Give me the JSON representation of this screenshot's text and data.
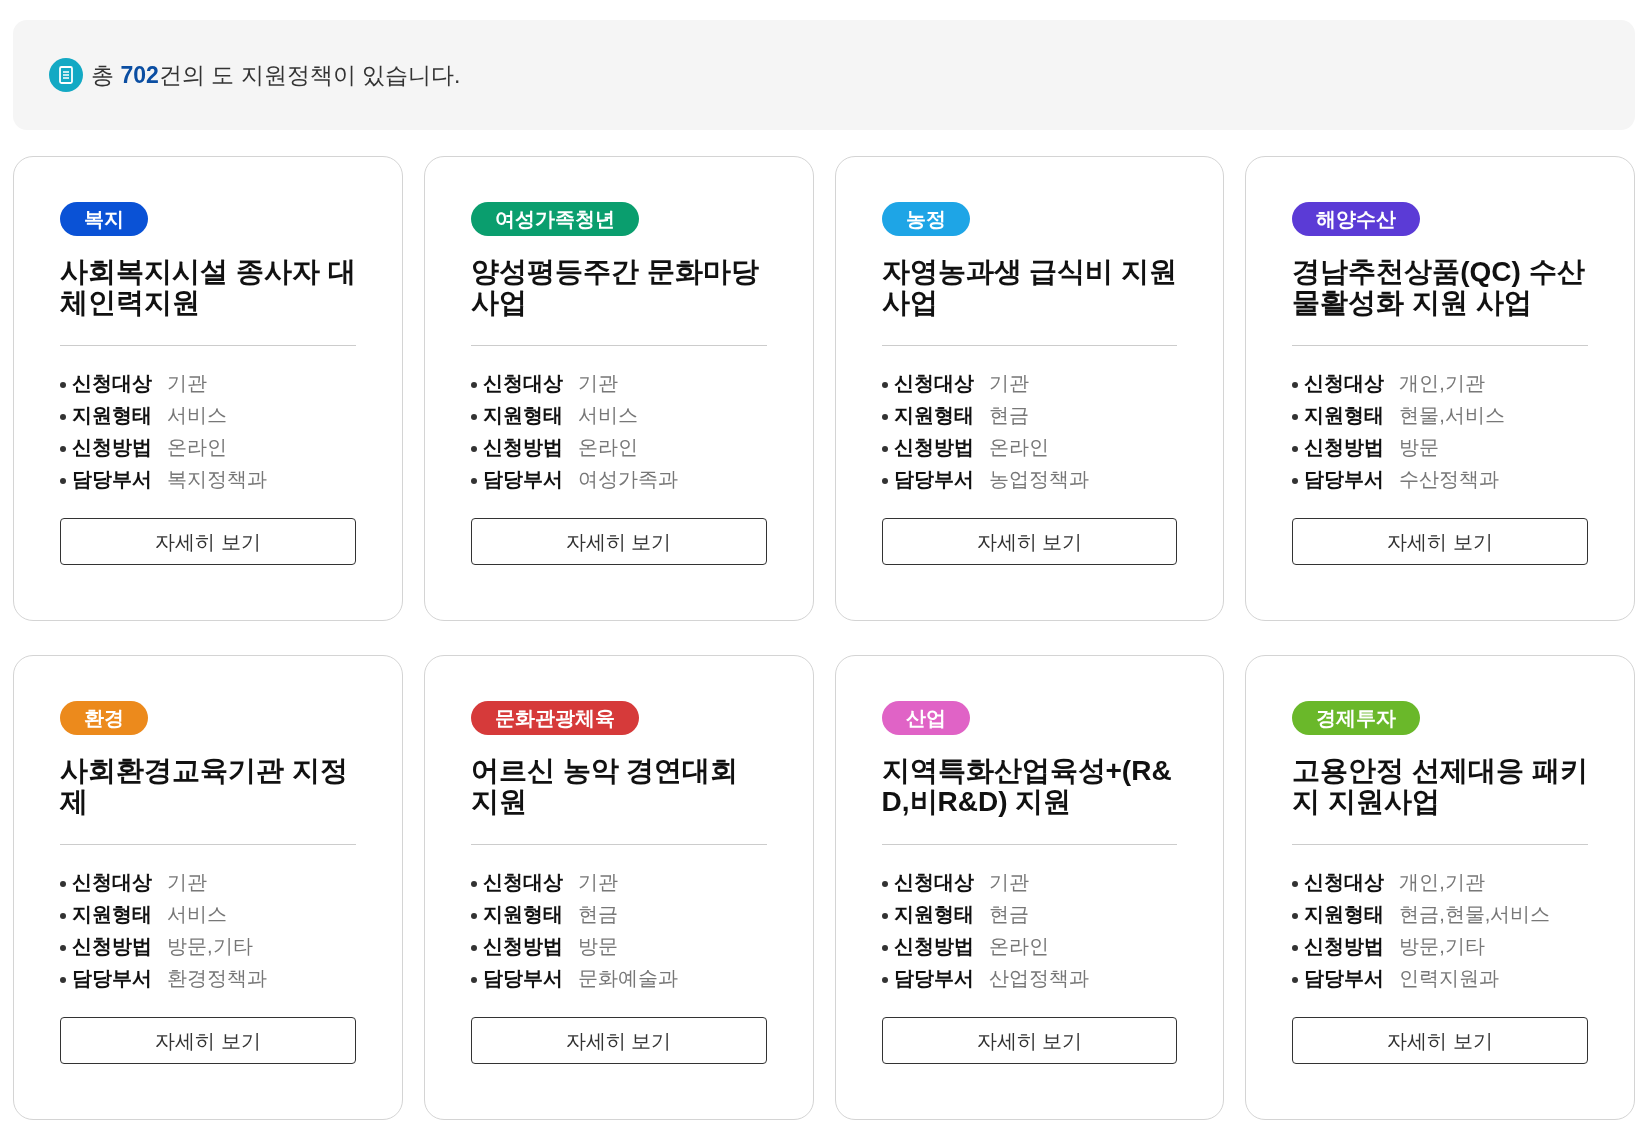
{
  "summary": {
    "text": "총 **702**건의 도 지원정책이 있습니다."
  },
  "cards": [
    {
      "tag": "복지",
      "color": "#0a52d6",
      "title": "사회복지시설 종사자 대체인력지원",
      "fields": [
        {
          "label": "신청대상",
          "value": "기관"
        },
        {
          "label": "지원형태",
          "value": "서비스"
        },
        {
          "label": "신청방법",
          "value": "온라인"
        },
        {
          "label": "담당부서",
          "value": "복지정책과"
        }
      ],
      "button": "자세히 보기"
    },
    {
      "tag": "여성가족청년",
      "color": "#0a9e6e",
      "title": "양성평등주간 문화마당 사업",
      "fields": [
        {
          "label": "신청대상",
          "value": "기관"
        },
        {
          "label": "지원형태",
          "value": "서비스"
        },
        {
          "label": "신청방법",
          "value": "온라인"
        },
        {
          "label": "담당부서",
          "value": "여성가족과"
        }
      ],
      "button": "자세히 보기"
    },
    {
      "tag": "농정",
      "color": "#1ea5e6",
      "title": "자영농과생 급식비 지원 사업",
      "fields": [
        {
          "label": "신청대상",
          "value": "기관"
        },
        {
          "label": "지원형태",
          "value": "현금"
        },
        {
          "label": "신청방법",
          "value": "온라인"
        },
        {
          "label": "담당부서",
          "value": "농업정책과"
        }
      ],
      "button": "자세히 보기"
    },
    {
      "tag": "해양수산",
      "color": "#5b3bd6",
      "title": "경남추천상품(QC) 수산물활성화 지원 사업",
      "fields": [
        {
          "label": "신청대상",
          "value": "개인,기관"
        },
        {
          "label": "지원형태",
          "value": "현물,서비스"
        },
        {
          "label": "신청방법",
          "value": "방문"
        },
        {
          "label": "담당부서",
          "value": "수산정책과"
        }
      ],
      "button": "자세히 보기"
    },
    {
      "tag": "환경",
      "color": "#ec8a1c",
      "title": "사회환경교육기관 지정제",
      "fields": [
        {
          "label": "신청대상",
          "value": "기관"
        },
        {
          "label": "지원형태",
          "value": "서비스"
        },
        {
          "label": "신청방법",
          "value": "방문,기타"
        },
        {
          "label": "담당부서",
          "value": "환경정책과"
        }
      ],
      "button": "자세히 보기"
    },
    {
      "tag": "문화관광체육",
      "color": "#d63a3a",
      "title": "어르신 농악 경연대회 지원",
      "fields": [
        {
          "label": "신청대상",
          "value": "기관"
        },
        {
          "label": "지원형태",
          "value": "현금"
        },
        {
          "label": "신청방법",
          "value": "방문"
        },
        {
          "label": "담당부서",
          "value": "문화예술과"
        }
      ],
      "button": "자세히 보기"
    },
    {
      "tag": "산업",
      "color": "#e063c6",
      "title": "지역특화산업육성+(R&D,비R&D) 지원",
      "fields": [
        {
          "label": "신청대상",
          "value": "기관"
        },
        {
          "label": "지원형태",
          "value": "현금"
        },
        {
          "label": "신청방법",
          "value": "온라인"
        },
        {
          "label": "담당부서",
          "value": "산업정책과"
        }
      ],
      "button": "자세히 보기"
    },
    {
      "tag": "경제투자",
      "color": "#6ab82a",
      "title": "고용안정 선제대응 패키지 지원사업",
      "fields": [
        {
          "label": "신청대상",
          "value": "개인,기관"
        },
        {
          "label": "지원형태",
          "value": "현금,현물,서비스"
        },
        {
          "label": "신청방법",
          "value": "방문,기타"
        },
        {
          "label": "담당부서",
          "value": "인력지원과"
        }
      ],
      "button": "자세히 보기"
    }
  ]
}
